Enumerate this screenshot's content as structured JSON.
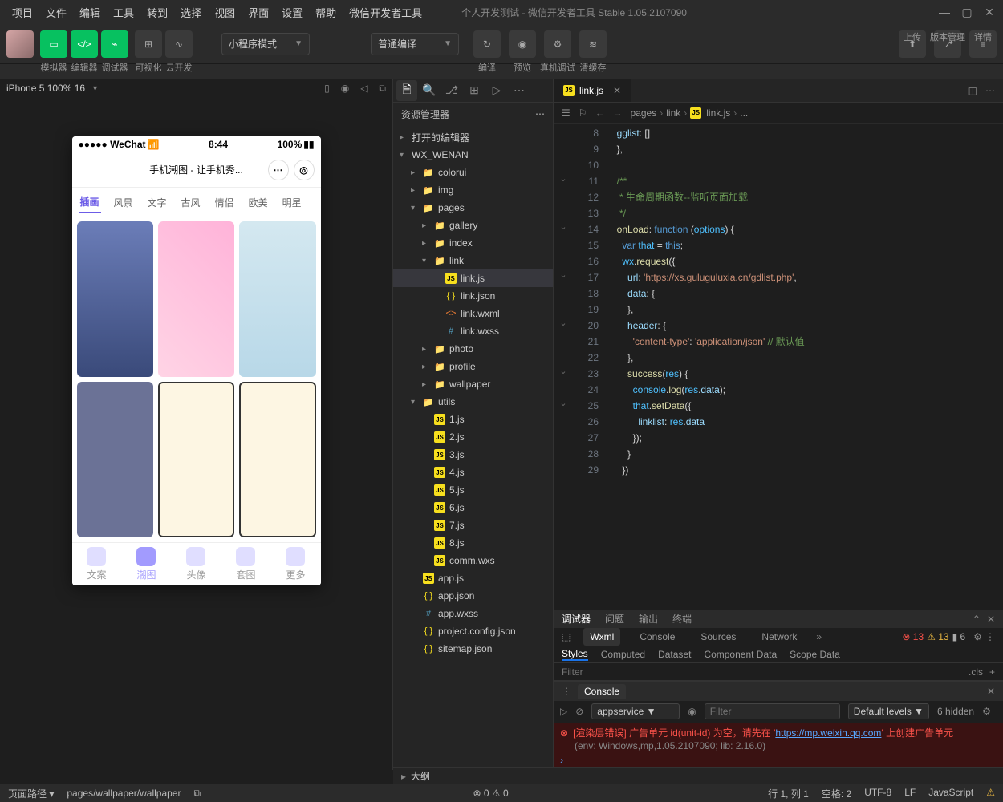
{
  "menu": [
    "项目",
    "文件",
    "编辑",
    "工具",
    "转到",
    "选择",
    "视图",
    "界面",
    "设置",
    "帮助",
    "微信开发者工具"
  ],
  "title": "个人开发测试 - 微信开发者工具 Stable 1.05.2107090",
  "toolbar": {
    "group1": [
      "模拟器",
      "编辑器",
      "调试器"
    ],
    "group2": [
      "可视化",
      "云开发"
    ],
    "select1": "小程序模式",
    "select2": "普通编译",
    "actions": [
      "编译",
      "预览",
      "真机调试",
      "清缓存"
    ],
    "right": [
      "上传",
      "版本管理",
      "详情"
    ]
  },
  "simulator": {
    "status": "iPhone 5 100% 16",
    "phone_status_left": "●●●●● WeChat",
    "phone_status_time": "8:44",
    "phone_status_batt": "100%",
    "phone_title": "手机潮图 - 让手机秀...",
    "phone_tabs": [
      "插画",
      "风景",
      "文字",
      "古风",
      "情侣",
      "欧美",
      "明星"
    ],
    "phone_bottom": [
      "文案",
      "潮图",
      "头像",
      "套图",
      "更多"
    ]
  },
  "explorer": {
    "title": "资源管理器",
    "sections": {
      "open_editors": "打开的编辑器",
      "project": "WX_WENAN"
    },
    "tree": [
      {
        "name": "colorui",
        "type": "folder",
        "indent": 1
      },
      {
        "name": "img",
        "type": "folder-special",
        "indent": 1
      },
      {
        "name": "pages",
        "type": "folder-special",
        "indent": 1,
        "open": true
      },
      {
        "name": "gallery",
        "type": "folder",
        "indent": 2
      },
      {
        "name": "index",
        "type": "folder",
        "indent": 2
      },
      {
        "name": "link",
        "type": "folder",
        "indent": 2,
        "open": true
      },
      {
        "name": "link.js",
        "type": "js",
        "indent": 3,
        "selected": true
      },
      {
        "name": "link.json",
        "type": "json",
        "indent": 3
      },
      {
        "name": "link.wxml",
        "type": "wxml",
        "indent": 3
      },
      {
        "name": "link.wxss",
        "type": "wxss",
        "indent": 3
      },
      {
        "name": "photo",
        "type": "folder",
        "indent": 2
      },
      {
        "name": "profile",
        "type": "folder",
        "indent": 2
      },
      {
        "name": "wallpaper",
        "type": "folder",
        "indent": 2
      },
      {
        "name": "utils",
        "type": "folder-special",
        "indent": 1,
        "open": true
      },
      {
        "name": "1.js",
        "type": "js",
        "indent": 2
      },
      {
        "name": "2.js",
        "type": "js",
        "indent": 2
      },
      {
        "name": "3.js",
        "type": "js",
        "indent": 2
      },
      {
        "name": "4.js",
        "type": "js",
        "indent": 2
      },
      {
        "name": "5.js",
        "type": "js",
        "indent": 2
      },
      {
        "name": "6.js",
        "type": "js",
        "indent": 2
      },
      {
        "name": "7.js",
        "type": "js",
        "indent": 2
      },
      {
        "name": "8.js",
        "type": "js",
        "indent": 2
      },
      {
        "name": "comm.wxs",
        "type": "js",
        "indent": 2
      },
      {
        "name": "app.js",
        "type": "js",
        "indent": 1
      },
      {
        "name": "app.json",
        "type": "json",
        "indent": 1
      },
      {
        "name": "app.wxss",
        "type": "wxss",
        "indent": 1
      },
      {
        "name": "project.config.json",
        "type": "json",
        "indent": 1
      },
      {
        "name": "sitemap.json",
        "type": "json",
        "indent": 1
      }
    ],
    "outline": "大纲"
  },
  "editor": {
    "tab": "link.js",
    "breadcrumb": [
      "pages",
      "link",
      "link.js",
      "..."
    ],
    "line_start": 8,
    "code": {
      "cm1": "    gglist: []",
      "cm2": "  },",
      "cm_blank1": "",
      "cm_docstart": "  /**",
      "cm_docbody": "   * 生命周期函数--监听页面加载",
      "cm_docend": "   */",
      "onload_kw": "onLoad",
      "func_kw": "function",
      "options": "options",
      "var_line": "var that = this;",
      "wx_request": "wx.request({",
      "url_label": "url: ",
      "url_val": "'https://xs.guluguluxia.cn/gdlist.php'",
      "data_open": "data: {",
      "brace_close": "},",
      "header_open": "header: {",
      "content_type": "'content-type': 'application/json'",
      "default_cm": " // 默认值",
      "success": "success",
      "res": "res",
      "console_line": "console.log(res.data);",
      "setdata": "that.setData({",
      "linklist": "linklist: res.data",
      "close1": "});",
      "close2": "}",
      "close3": "})"
    }
  },
  "devtools": {
    "tabs": [
      "调试器",
      "问题",
      "输出",
      "终端"
    ],
    "sub_tabs": [
      "Wxml",
      "Console",
      "Sources",
      "Network"
    ],
    "badges": {
      "err": "13",
      "warn": "13",
      "info": "6"
    },
    "styles_tabs": [
      "Styles",
      "Computed",
      "Dataset",
      "Component Data",
      "Scope Data"
    ],
    "filter_ph": "Filter",
    "cls": ".cls"
  },
  "console": {
    "tab": "Console",
    "context": "appservice",
    "filter_ph": "Filter",
    "levels": "Default levels",
    "hidden": "6 hidden",
    "err1_pre": "[渲染层错误] 广告单元 id(unit-id) 为空，请先在 '",
    "err1_url": "https://mp.weixin.qq.com",
    "err1_post": "' 上创建广告单元",
    "env": "(env: Windows,mp,1.05.2107090; lib: 2.16.0)"
  },
  "statusbar": {
    "left_label": "页面路径",
    "path": "pages/wallpaper/wallpaper",
    "warn_count": "0",
    "err_count": "0",
    "line_col": "行 1, 列 1",
    "spaces": "空格: 2",
    "encoding": "UTF-8",
    "eol": "LF",
    "lang": "JavaScript"
  }
}
